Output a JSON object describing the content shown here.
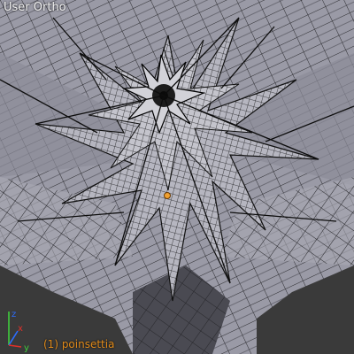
{
  "viewport": {
    "view_name": "User Ortho",
    "active_object": "(1) poinsettia"
  },
  "axes": {
    "x_label": "x",
    "y_label": "y",
    "z_label": "z",
    "x_color": "#e0302a",
    "y_color": "#3fcc3c",
    "z_color": "#2d6cff"
  },
  "colors": {
    "mesh_fill": "#a0a0ab",
    "mesh_shadow": "#5b5b64",
    "wire": "#111111",
    "background": "#3a3a3a",
    "origin": "#f0a030",
    "label_orange": "#e08a1a"
  },
  "icons": [
    "axis-gizmo-icon",
    "object-origin-icon"
  ]
}
